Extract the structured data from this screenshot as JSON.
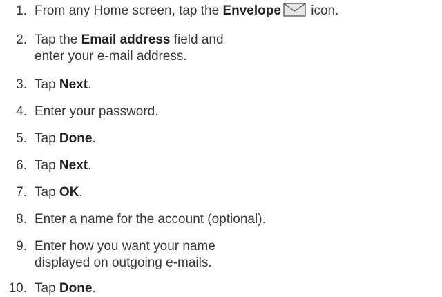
{
  "icons": {
    "envelope": "envelope-icon"
  },
  "colors": {
    "text": "#3a3a3a",
    "icon_fill": "#e6e6e6",
    "icon_stroke": "#555555"
  },
  "steps": [
    {
      "num": "1.",
      "before": "From any Home screen, tap the ",
      "bold": "Envelope",
      "after": " icon."
    },
    {
      "num": "2.",
      "before": "Tap the ",
      "bold": "Email address",
      "after": " field and",
      "line2": "enter your e-mail address."
    },
    {
      "num": "3.",
      "before": "Tap ",
      "bold": "Next",
      "after": "."
    },
    {
      "num": "4.",
      "before": "Enter your password."
    },
    {
      "num": "5.",
      "before": "Tap ",
      "bold": "Done",
      "after": "."
    },
    {
      "num": "6.",
      "before": "Tap ",
      "bold": "Next",
      "after": "."
    },
    {
      "num": "7.",
      "before": "Tap ",
      "bold": "OK",
      "after": "."
    },
    {
      "num": "8.",
      "before": "Enter a name for the account (optional)."
    },
    {
      "num": "9.",
      "before": "Enter how you want your name",
      "line2": "displayed on outgoing e-mails."
    },
    {
      "num": "10.",
      "before": "Tap ",
      "bold": "Done",
      "after": "."
    }
  ]
}
